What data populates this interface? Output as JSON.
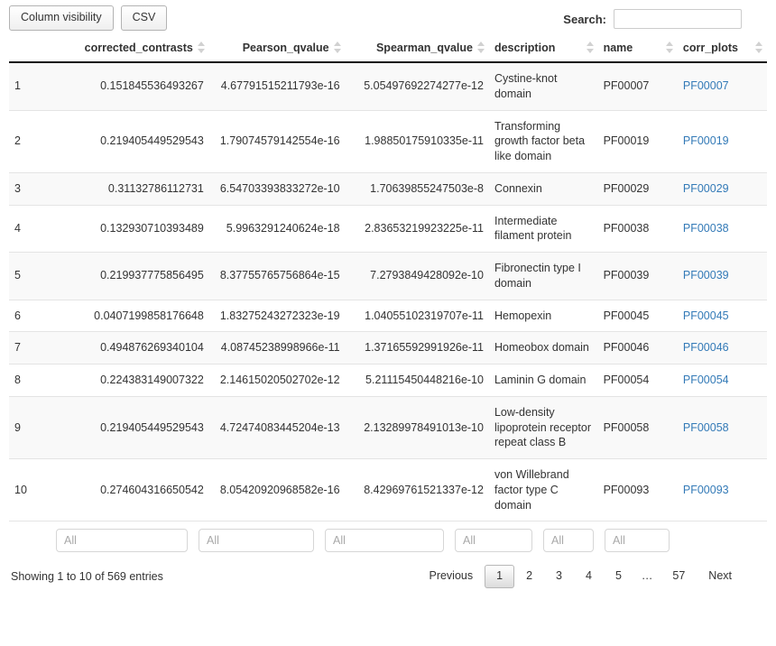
{
  "toolbar": {
    "column_visibility_label": "Column visibility",
    "csv_label": "CSV"
  },
  "search": {
    "label": "Search:",
    "value": "",
    "placeholder": ""
  },
  "table": {
    "columns": [
      {
        "key": "index",
        "label": "",
        "sortable": false
      },
      {
        "key": "corrected_contrasts",
        "label": "corrected_contrasts",
        "sortable": true
      },
      {
        "key": "Pearson_qvalue",
        "label": "Pearson_qvalue",
        "sortable": true
      },
      {
        "key": "Spearman_qvalue",
        "label": "Spearman_qvalue",
        "sortable": true
      },
      {
        "key": "description",
        "label": "description",
        "sortable": true
      },
      {
        "key": "name",
        "label": "name",
        "sortable": true
      },
      {
        "key": "corr_plots",
        "label": "corr_plots",
        "sortable": true
      }
    ],
    "rows": [
      {
        "index": "1",
        "corrected_contrasts": "0.151845536493267",
        "Pearson_qvalue": "4.67791515211793e-16",
        "Spearman_qvalue": "5.05497692274277e-12",
        "description": "Cystine-knot domain",
        "name": "PF00007",
        "corr_plots": "PF00007"
      },
      {
        "index": "2",
        "corrected_contrasts": "0.219405449529543",
        "Pearson_qvalue": "1.79074579142554e-16",
        "Spearman_qvalue": "1.98850175910335e-11",
        "description": "Transforming growth factor beta like domain",
        "name": "PF00019",
        "corr_plots": "PF00019"
      },
      {
        "index": "3",
        "corrected_contrasts": "0.31132786112731",
        "Pearson_qvalue": "6.54703393833272e-10",
        "Spearman_qvalue": "1.70639855247503e-8",
        "description": "Connexin",
        "name": "PF00029",
        "corr_plots": "PF00029"
      },
      {
        "index": "4",
        "corrected_contrasts": "0.132930710393489",
        "Pearson_qvalue": "5.9963291240624e-18",
        "Spearman_qvalue": "2.83653219923225e-11",
        "description": "Intermediate filament protein",
        "name": "PF00038",
        "corr_plots": "PF00038"
      },
      {
        "index": "5",
        "corrected_contrasts": "0.219937775856495",
        "Pearson_qvalue": "8.37755765756864e-15",
        "Spearman_qvalue": "7.2793849428092e-10",
        "description": "Fibronectin type I domain",
        "name": "PF00039",
        "corr_plots": "PF00039"
      },
      {
        "index": "6",
        "corrected_contrasts": "0.0407199858176648",
        "Pearson_qvalue": "1.83275243272323e-19",
        "Spearman_qvalue": "1.04055102319707e-11",
        "description": "Hemopexin",
        "name": "PF00045",
        "corr_plots": "PF00045"
      },
      {
        "index": "7",
        "corrected_contrasts": "0.494876269340104",
        "Pearson_qvalue": "4.08745238998966e-11",
        "Spearman_qvalue": "1.37165592991926e-11",
        "description": "Homeobox domain",
        "name": "PF00046",
        "corr_plots": "PF00046"
      },
      {
        "index": "8",
        "corrected_contrasts": "0.224383149007322",
        "Pearson_qvalue": "2.14615020502702e-12",
        "Spearman_qvalue": "5.21115450448216e-10",
        "description": "Laminin G domain",
        "name": "PF00054",
        "corr_plots": "PF00054"
      },
      {
        "index": "9",
        "corrected_contrasts": "0.219405449529543",
        "Pearson_qvalue": "4.72474083445204e-13",
        "Spearman_qvalue": "2.13289978491013e-10",
        "description": "Low-density lipoprotein receptor repeat class B",
        "name": "PF00058",
        "corr_plots": "PF00058"
      },
      {
        "index": "10",
        "corrected_contrasts": "0.274604316650542",
        "Pearson_qvalue": "8.05420920968582e-16",
        "Spearman_qvalue": "8.42969761521337e-12",
        "description": "von Willebrand factor type C domain",
        "name": "PF00093",
        "corr_plots": "PF00093"
      }
    ]
  },
  "column_filters": [
    {
      "name": "corrected_contrasts",
      "placeholder": "All",
      "value": ""
    },
    {
      "name": "Pearson_qvalue",
      "placeholder": "All",
      "value": ""
    },
    {
      "name": "Spearman_qvalue",
      "placeholder": "All",
      "value": ""
    },
    {
      "name": "description",
      "placeholder": "All",
      "value": ""
    },
    {
      "name": "name",
      "placeholder": "All",
      "value": ""
    },
    {
      "name": "corr_plots",
      "placeholder": "All",
      "value": ""
    }
  ],
  "footer": {
    "info": "Showing 1 to 10 of 569 entries",
    "pagination": {
      "previous_label": "Previous",
      "next_label": "Next",
      "ellipsis": "…",
      "current_page": "1",
      "pages": [
        "1",
        "2",
        "3",
        "4",
        "5",
        "…",
        "57"
      ]
    }
  },
  "colors": {
    "link": "#337ab7",
    "row_stripe": "#f9f9f9",
    "header_border": "#111111"
  }
}
